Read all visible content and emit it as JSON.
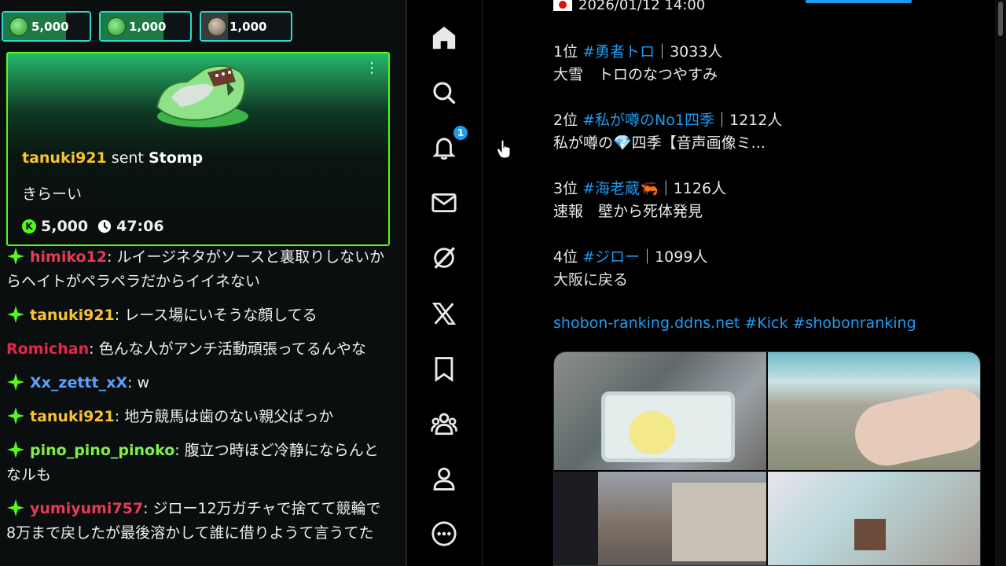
{
  "chat": {
    "balances": [
      {
        "amount": "5,000",
        "icon": "green-coin-icon"
      },
      {
        "amount": "1,000",
        "icon": "green-coin-icon"
      },
      {
        "amount": "1,000",
        "icon": "avatar-coin-icon"
      }
    ],
    "gift": {
      "user": "tanuki921",
      "sent_text": " sent ",
      "gift_name": "Stomp",
      "message": "きらーい",
      "amount": "5,000",
      "timer": "47:06"
    },
    "messages": [
      {
        "badge": true,
        "user": "himiko12",
        "user_color": "#e53b56",
        "text": ": ルイージネタがソースと裏取りしないからヘイトがペラペラだからイイネない"
      },
      {
        "badge": true,
        "user": "tanuki921",
        "user_color": "#f8c331",
        "text": ": レース場にいそうな顔してる"
      },
      {
        "badge": false,
        "user": "Romichan",
        "user_color": "#e8244a",
        "text": ": 色んな人がアンチ活動頑張ってるんやな"
      },
      {
        "badge": true,
        "user": "Xx_zettt_xX",
        "user_color": "#5aa2ff",
        "text": ": w"
      },
      {
        "badge": true,
        "user": "tanuki921",
        "user_color": "#f8c331",
        "text": ": 地方競馬は歯のない親父ばっか"
      },
      {
        "badge": true,
        "user": "pino_pino_pinoko",
        "user_color": "#7ef04a",
        "text": ": 腹立つ時ほど冷静にならんとなルも"
      },
      {
        "badge": true,
        "user": "yumiyumi757",
        "user_color": "#e53b56",
        "text": ": ジロー12万ガチャで捨てて競輪で8万まで戻したが最後溶かして誰に借りようて言うてた"
      }
    ]
  },
  "nav": {
    "items": [
      "home-icon",
      "search-icon",
      "bell-icon",
      "mail-icon",
      "grok-icon",
      "x-logo-icon",
      "bookmark-icon",
      "communities-icon",
      "profile-icon",
      "more-icon"
    ],
    "notification_count": "1"
  },
  "post": {
    "timestamp": "2026/01/12 14:00",
    "ranks": [
      {
        "rank": "1位 ",
        "tag": "#勇者トロ",
        "count": "｜3033人",
        "desc": "大雪　トロのなつやすみ"
      },
      {
        "rank": "2位 ",
        "tag": "#私が噂のNo1四季",
        "count": "｜1212人",
        "desc": "私が噂の💎四季【音声画像ミ..."
      },
      {
        "rank": "3位 ",
        "tag": "#海老蔵🦐",
        "count": "｜1126人",
        "desc": "速報　壁から死体発見"
      },
      {
        "rank": "4位 ",
        "tag": "#ジロー",
        "count": "｜1099人",
        "desc": "大阪に戻る"
      }
    ],
    "links": "shobon-ranking.ddns.net #Kick #shobonranking"
  },
  "colors": {
    "kick_green": "#53fc18",
    "x_blue": "#1d9bf0"
  }
}
